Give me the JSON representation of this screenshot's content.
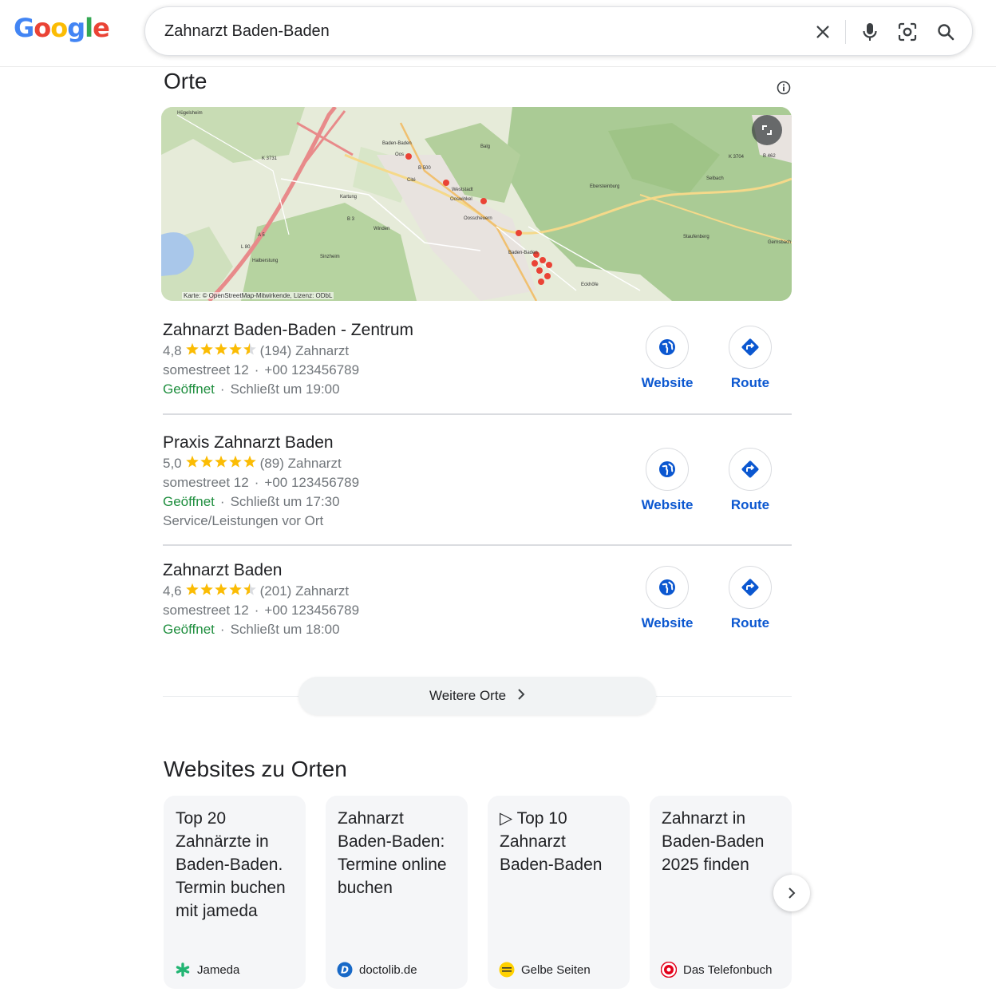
{
  "header": {
    "logo_text": "Google",
    "search_value": "Zahnarzt Baden-Baden"
  },
  "orte": {
    "title": "Orte",
    "map_attribution": "Karte: © OpenStreetMap-Mitwirkende, Lizenz: ODbL",
    "map_labels": {
      "huegelsheim": "Hügelsheim",
      "baden_baden_top": "Baden-Baden",
      "oos": "Oos",
      "balg": "Balg",
      "cite": "Cité",
      "weststadt": "Weststadt",
      "ooswinkel": "Ooswinkel",
      "kartung": "Kartung",
      "oosscheuern": "Oosscheuern",
      "ebersteinburg": "Ebersteinburg",
      "selbach": "Selbach",
      "winden": "Winden",
      "halberstung": "Halberstung",
      "sinzheim": "Sinzheim",
      "baden_baden": "Baden-Baden",
      "staufenberg": "Staufenberg",
      "gernsbach": "Gernsbach",
      "eckhofe": "Eckhöfe",
      "k3731": "K 3731",
      "b500": "B 500",
      "b3": "B 3",
      "a5": "A 5",
      "l80": "L 80",
      "k3704": "K 3704",
      "b462": "B 462"
    },
    "places": [
      {
        "name": "Zahnarzt Baden-Baden - Zentrum",
        "rating": "4,8",
        "reviews": "(194)",
        "category": "Zahnarzt",
        "address": "somestreet 12",
        "phone": "+00 123456789",
        "status": "Geöffnet",
        "hours": "Schließt um 19:00",
        "extra": "",
        "stars_filled": 4.5,
        "website_label": "Website",
        "route_label": "Route"
      },
      {
        "name": "Praxis Zahnarzt Baden",
        "rating": "5,0",
        "reviews": "(89)",
        "category": "Zahnarzt",
        "address": "somestreet 12",
        "phone": "+00 123456789",
        "status": "Geöffnet",
        "hours": "Schließt um 17:30",
        "extra": "Service/Leistungen vor Ort",
        "stars_filled": 5,
        "website_label": "Website",
        "route_label": "Route"
      },
      {
        "name": "Zahnarzt Baden",
        "rating": "4,6",
        "reviews": "(201)",
        "category": "Zahnarzt",
        "address": "somestreet 12",
        "phone": "+00 123456789",
        "status": "Geöffnet",
        "hours": "Schließt um 18:00",
        "extra": "",
        "stars_filled": 4.5,
        "website_label": "Website",
        "route_label": "Route"
      }
    ],
    "separator": "·",
    "more_label": "Weitere Orte"
  },
  "websites": {
    "title": "Websites zu Orten",
    "cards": [
      {
        "title": "Top 20 Zahnärzte in Baden-Baden. Termin buchen mit jameda",
        "source": "Jameda"
      },
      {
        "title": "Zahnarzt Baden-Baden: Termine online buchen",
        "source": "doctolib.de"
      },
      {
        "title": "▷ Top 10 Zahnarzt Baden-Baden",
        "source": "Gelbe Seiten"
      },
      {
        "title": "Zahnarzt in Baden-Baden 2025 finden",
        "source": "Das Telefonbuch"
      }
    ]
  },
  "colors": {
    "link_blue": "#0b57d0",
    "open_green": "#1e8e3e",
    "star_yellow": "#fbbc04",
    "pin_red": "#ea4335"
  },
  "icons": {
    "clear": "close-icon",
    "voice": "mic-icon",
    "lens": "lens-icon",
    "search": "search-icon",
    "info": "info-icon",
    "expand": "expand-icon",
    "website": "globe-icon",
    "route": "directions-icon",
    "more": "chevron-right-icon",
    "next": "chevron-right-icon"
  }
}
